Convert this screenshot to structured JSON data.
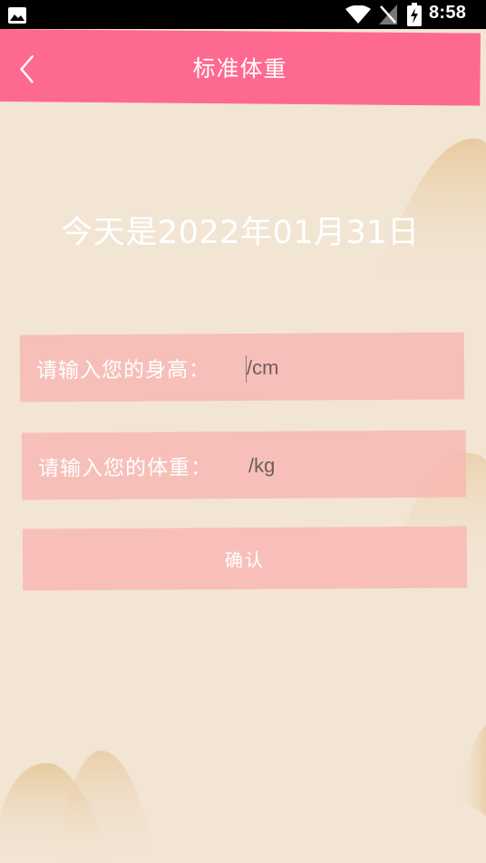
{
  "status_bar": {
    "time": "8:58",
    "icons": [
      "gallery-icon",
      "wifi-icon",
      "no-signal-icon",
      "battery-charging-icon"
    ]
  },
  "header": {
    "title": "标准体重",
    "back_icon": "chevron-left-icon"
  },
  "main": {
    "date_text": "今天是2022年01月31日",
    "height_field": {
      "label": "请输入您的身高：",
      "placeholder": "/cm",
      "value": ""
    },
    "weight_field": {
      "label": "请输入您的体重：",
      "placeholder": "/kg",
      "value": ""
    },
    "confirm_label": "确认"
  },
  "colors": {
    "header": "#fe6990",
    "background": "#f2e5d4",
    "field": "#f8b8b4",
    "text": "#ffffff"
  }
}
